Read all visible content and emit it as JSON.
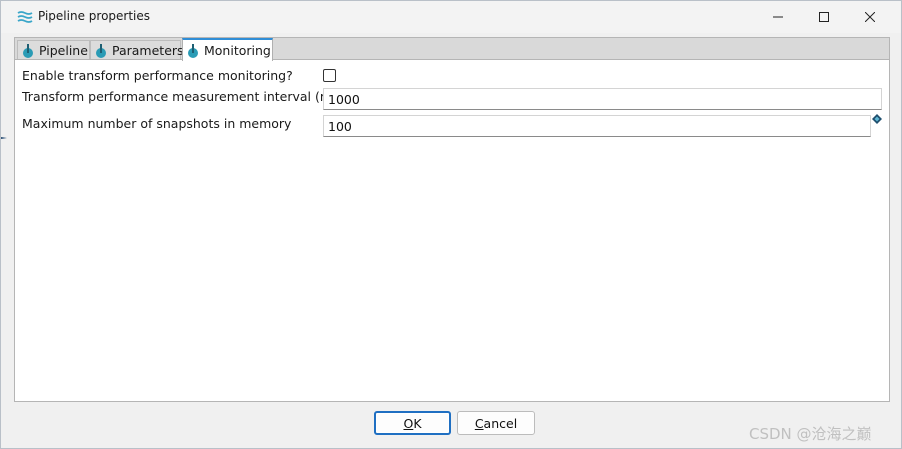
{
  "window": {
    "title": "Pipeline properties"
  },
  "tabs": [
    {
      "label": "Pipeline",
      "active": false
    },
    {
      "label": "Parameters",
      "active": false
    },
    {
      "label": "Monitoring",
      "active": true
    }
  ],
  "monitoring": {
    "enable_label": "Enable transform performance monitoring?",
    "enable_checked": false,
    "interval_label": "Transform performance measurement interval (ms)",
    "interval_value": "1000",
    "snapshots_label": "Maximum number of snapshots in memory",
    "snapshots_value": "100"
  },
  "buttons": {
    "ok_mnemonic": "O",
    "ok_rest": "K",
    "cancel_mnemonic": "C",
    "cancel_rest": "ancel"
  },
  "watermark": "CSDN @沧海之巅",
  "colors": {
    "accent": "#2f8dd6",
    "tab_icon": "#2a9bb5",
    "default_button_border": "#1f6fc2"
  },
  "icons": {
    "app": "pipeline-wave-icon",
    "tab": "hop-transform-icon",
    "variable": "variable-diamond-icon"
  }
}
